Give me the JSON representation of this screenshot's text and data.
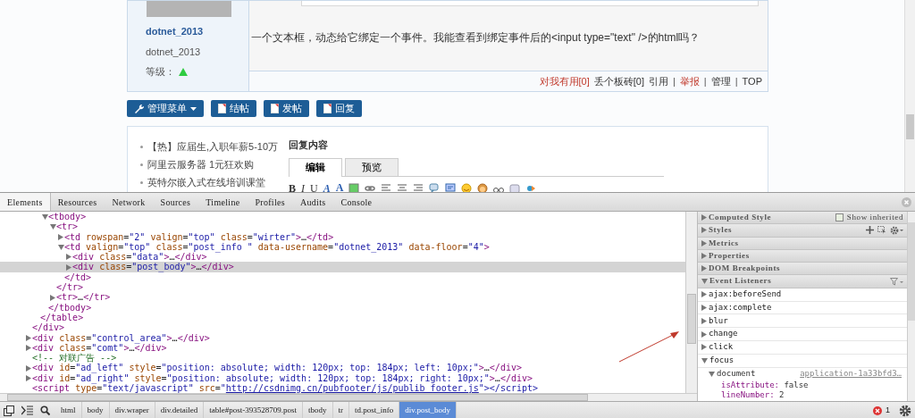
{
  "post": {
    "author_name": "dotnet_2013",
    "author_id": "dotnet_2013",
    "level_label": "等级：",
    "body": "一个文本框，动态给它绑定一个事件。我能查看到绑定事件后的<input type=\"text\" />的html吗？",
    "actions": [
      {
        "label": "对我有用[0]",
        "kind": "highlight"
      },
      {
        "label": "丢个板砖[0]",
        "kind": "normal"
      },
      {
        "label": "引用",
        "kind": "normal"
      },
      {
        "label": "|",
        "kind": "separator"
      },
      {
        "label": "举报",
        "kind": "highlight"
      },
      {
        "label": "|",
        "kind": "separator"
      },
      {
        "label": "管理",
        "kind": "normal"
      },
      {
        "label": "|",
        "kind": "separator"
      },
      {
        "label": "TOP",
        "kind": "normal"
      }
    ]
  },
  "buttons": [
    {
      "label": "管理菜单",
      "kind": "dropdown"
    },
    {
      "label": "结帖",
      "kind": "plain"
    },
    {
      "label": "发帖",
      "kind": "plain"
    },
    {
      "label": "回复",
      "kind": "plain"
    }
  ],
  "ads": [
    "【热】应届生,入职年薪5-10万",
    "阿里云服务器 1元狂欢购",
    "英特尔嵌入式在线培训课堂"
  ],
  "reply": {
    "title": "回复内容",
    "tabs": [
      {
        "label": "编辑",
        "selected": true
      },
      {
        "label": "预览",
        "selected": false
      }
    ],
    "toolbar": [
      {
        "label": "B",
        "kind": "bold"
      },
      {
        "label": "I",
        "kind": "italic"
      },
      {
        "label": "U",
        "kind": "underline"
      },
      {
        "label": "A",
        "kind": "font"
      },
      {
        "label": "A",
        "kind": "color"
      }
    ]
  },
  "devtools": {
    "tabs": [
      {
        "label": "Elements",
        "selected": true
      },
      {
        "label": "Resources",
        "selected": false
      },
      {
        "label": "Network",
        "selected": false
      },
      {
        "label": "Sources",
        "selected": false
      },
      {
        "label": "Timeline",
        "selected": false
      },
      {
        "label": "Profiles",
        "selected": false
      },
      {
        "label": "Audits",
        "selected": false
      },
      {
        "label": "Console",
        "selected": false
      }
    ],
    "dom_tree": [
      {
        "closing": "</div>",
        "children": [
          {
            "closing": "</table>",
            "children": [
              {
                "text": "<tbody>",
                "expanded": true,
                "selected": false,
                "closing": "</tbody>",
                "children": [
                  {
                    "text": "<tr>",
                    "expanded": true,
                    "selected": false,
                    "closing": "</tr>",
                    "children": [
                      {
                        "text": "<td rowspan=\"2\" valign=\"top\" class=\"wirter\">…</td>",
                        "expanded": false,
                        "selected": false
                      },
                      {
                        "text": "<td valign=\"top\" class=\"post_info \" data-username=\"dotnet_2013\" data-floor=\"4\">",
                        "expanded": true,
                        "selected": false,
                        "closing": "</td>",
                        "children": [
                          {
                            "text": "<div class=\"data\">…</div>",
                            "expanded": false,
                            "selected": false
                          },
                          {
                            "text": "<div class=\"post_body\">…</div>",
                            "expanded": false,
                            "selected": true
                          }
                        ]
                      }
                    ]
                  },
                  {
                    "text": "<tr>…</tr>",
                    "expanded": false,
                    "selected": false
                  }
                ]
              }
            ]
          }
        ]
      },
      {
        "text": "<div class=\"control_area\">…</div>",
        "expanded": false,
        "selected": false
      },
      {
        "text": "<div class=\"comt\">…</div>",
        "expanded": false,
        "selected": false
      },
      {
        "text": "<!-- 对联广告 -->",
        "kind": "comment",
        "selected": false
      },
      {
        "text": "<div id=\"ad_left\" style=\"position: absolute; width: 120px; top: 184px; left: 10px;\">…</div>",
        "expanded": false,
        "selected": false
      },
      {
        "text": "<div id=\"ad_right\" style=\"position: absolute; width: 120px; top: 184px; right: 10px;\">…</div>",
        "expanded": false,
        "selected": false
      },
      {
        "parts": [
          {
            "text": "<script type=\"text/javascript\" src=\""
          },
          {
            "text": "http://csdnimg.cn/pubfooter/js/publib_footer.js",
            "kind": "link"
          },
          {
            "text": "\"></script>"
          }
        ],
        "selected": false
      }
    ],
    "sidebar": {
      "sections": [
        {
          "title": "Computed Style",
          "expanded": false,
          "kind": "computed",
          "checkbox": {
            "label": "Show inherited",
            "checked": false
          }
        },
        {
          "title": "Styles",
          "expanded": false,
          "kind": "styles"
        },
        {
          "title": "Metrics",
          "expanded": false,
          "kind": "plain"
        },
        {
          "title": "Properties",
          "expanded": false,
          "kind": "plain"
        },
        {
          "title": "DOM Breakpoints",
          "expanded": false,
          "kind": "plain"
        },
        {
          "title": "Event Listeners",
          "expanded": true,
          "kind": "events"
        }
      ],
      "event_listeners": [
        {
          "name": "ajax:beforeSend",
          "expanded": false
        },
        {
          "name": "ajax:complete",
          "expanded": false
        },
        {
          "name": "blur",
          "expanded": false
        },
        {
          "name": "change",
          "expanded": false
        },
        {
          "name": "click",
          "expanded": false
        },
        {
          "name": "focus",
          "expanded": true,
          "children": [
            {
              "name": "document",
              "expanded": true,
              "source": "application-1a33bfd3…",
              "properties": [
                {
                  "name": "isAttribute:",
                  "value": "false"
                },
                {
                  "name": "lineNumber:",
                  "value": "2"
                }
              ]
            }
          ]
        }
      ]
    },
    "breadcrumbs": [
      {
        "label": "html",
        "selected": false
      },
      {
        "label": "body",
        "selected": false
      },
      {
        "label": "div.wraper",
        "selected": false
      },
      {
        "label": "div.detailed",
        "selected": false
      },
      {
        "label": "table#post-393528709.post",
        "selected": false
      },
      {
        "label": "tbody",
        "selected": false
      },
      {
        "label": "tr",
        "selected": false
      },
      {
        "label": "td.post_info",
        "selected": false
      },
      {
        "label": "div.post_body",
        "selected": true
      }
    ],
    "error_count": "1"
  }
}
